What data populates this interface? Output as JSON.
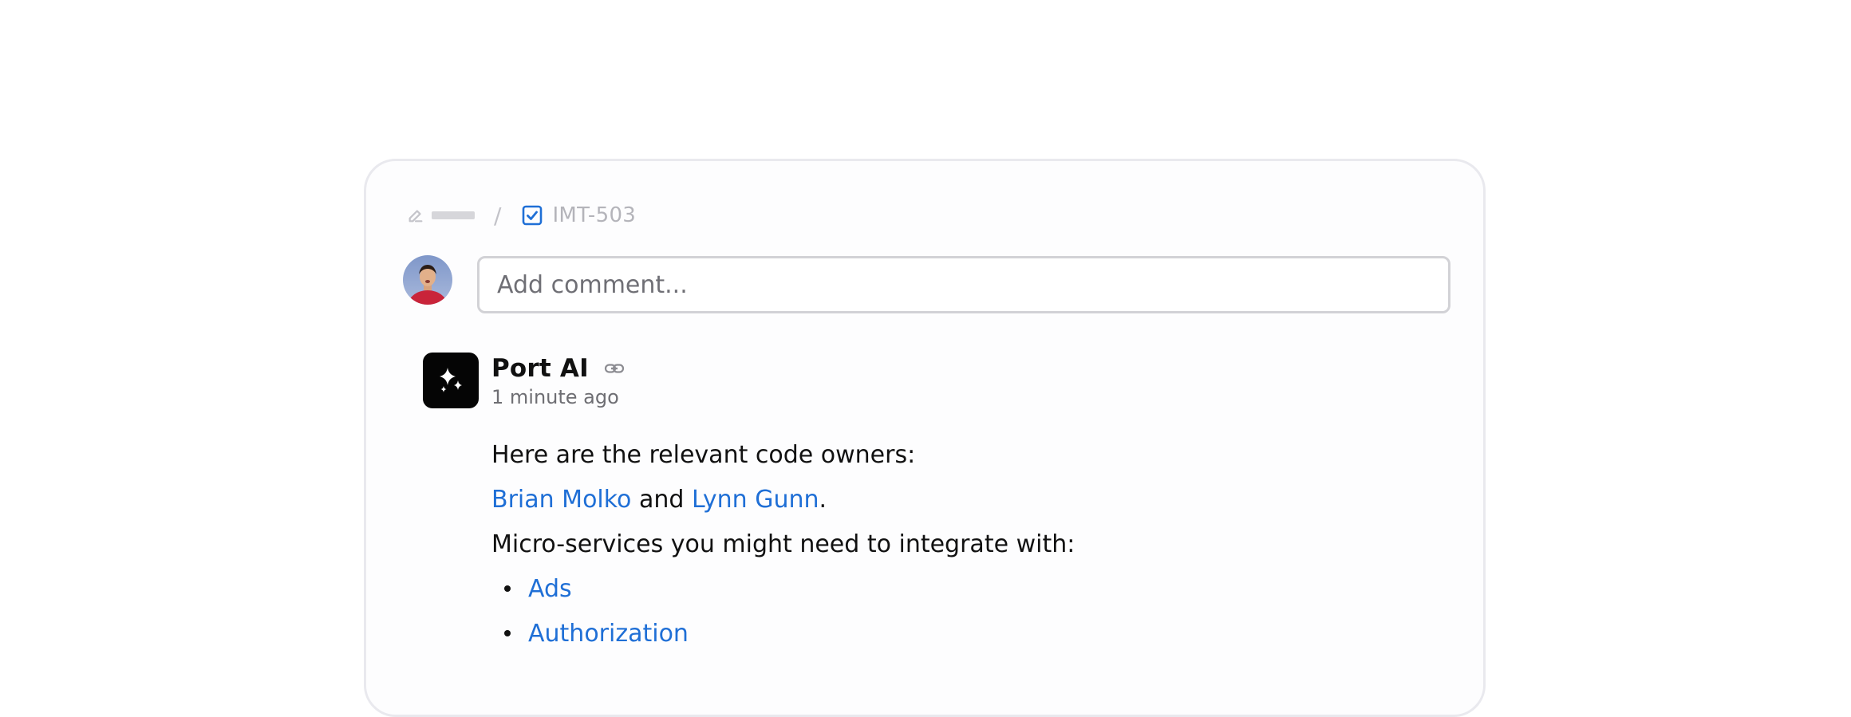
{
  "breadcrumb": {
    "separator": "/",
    "issue_key": "IMT-503"
  },
  "comment_box": {
    "placeholder": "Add comment..."
  },
  "comment": {
    "author": "Port AI",
    "timestamp": "1 minute ago",
    "intro": "Here are the relevant code owners:",
    "owner_1": "Brian Molko",
    "owner_joiner": " and ",
    "owner_2": "Lynn Gunn",
    "owner_end": ".",
    "services_intro": "Micro-services you might need to integrate with:",
    "services": [
      "Ads",
      "Authorization"
    ]
  },
  "colors": {
    "link": "#1f6fd6",
    "card_border": "#e9e9ee",
    "logo_bg": "#050505"
  },
  "icons": {
    "breadcrumb_left": "pencil-icon",
    "issue_type": "checkbox-icon",
    "permalink": "link-icon",
    "ai_logo": "sparkles-icon"
  }
}
